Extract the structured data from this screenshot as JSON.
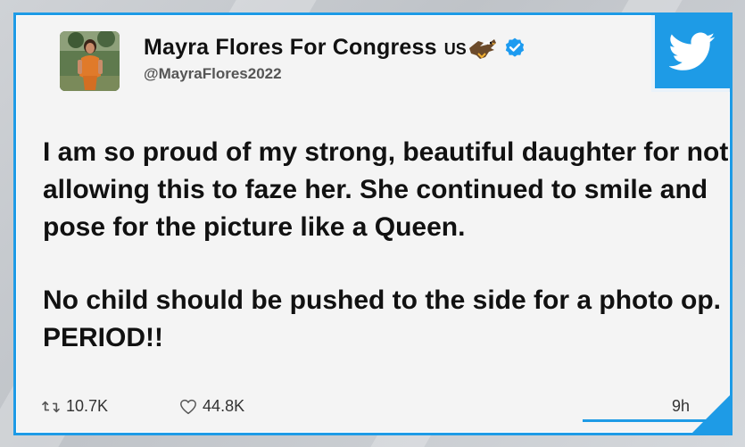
{
  "tweet": {
    "display_name": "Mayra Flores For Congress",
    "flag_text": "US",
    "handle": "@MayraFlores2022",
    "paragraphs": [
      "I am so proud of my strong, beautiful daughter for not allowing this to faze her. She continued to smile and pose for the picture like a Queen.",
      "No child should be pushed to the side for a photo op. PERIOD!!"
    ],
    "retweets": "10.7K",
    "likes": "44.8K",
    "timestamp": "9h"
  },
  "icons": {
    "eagle": "eagle-icon",
    "verified": "verified-badge-icon",
    "retweet": "retweet-icon",
    "like": "heart-icon",
    "brand": "twitter-bird-icon"
  },
  "colors": {
    "accent": "#1e9be6",
    "card_background": "#f4f4f4",
    "text": "#111111"
  }
}
